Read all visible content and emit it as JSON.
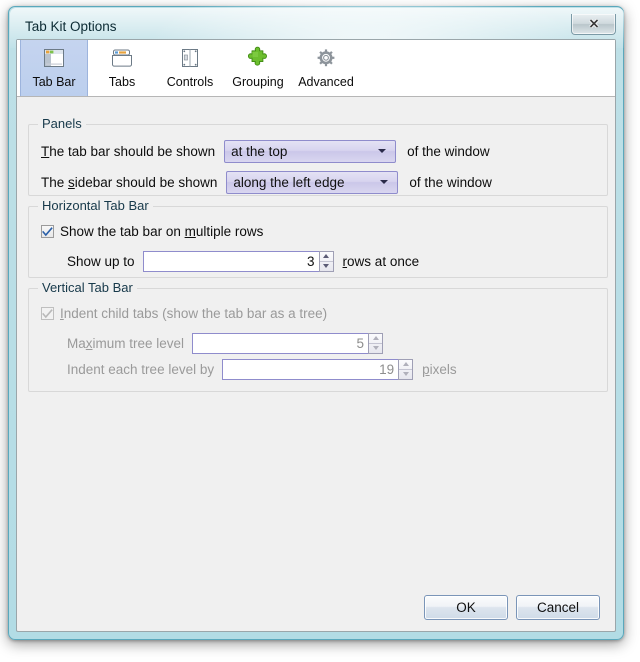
{
  "window": {
    "title": "Tab Kit Options",
    "close_icon": "close-icon"
  },
  "tabs": [
    {
      "label": "Tab Bar",
      "icon": "tab-bar-icon",
      "selected": true
    },
    {
      "label": "Tabs",
      "icon": "tabs-icon",
      "selected": false
    },
    {
      "label": "Controls",
      "icon": "controls-icon",
      "selected": false
    },
    {
      "label": "Grouping",
      "icon": "puzzle-piece-icon",
      "selected": false
    },
    {
      "label": "Advanced",
      "icon": "gear-icon",
      "selected": false
    }
  ],
  "panels": {
    "title": "Panels",
    "tab_bar_label_pre": "T",
    "tab_bar_label_post": "he tab bar should be shown",
    "tab_bar_value": "at the top",
    "tab_bar_suffix": "of the window",
    "sidebar_label_a": "The ",
    "sidebar_label_b": "s",
    "sidebar_label_c": "idebar should be shown",
    "sidebar_value": "along the left edge",
    "sidebar_suffix": "of the window"
  },
  "horizontal": {
    "title": "Horizontal Tab Bar",
    "checkbox_checked": true,
    "checkbox_label_a": "Show the tab bar on ",
    "checkbox_label_b": "m",
    "checkbox_label_c": "ultiple rows",
    "rows_label": "Show up to",
    "rows_value": "3",
    "rows_suffix_a": "r",
    "rows_suffix_b": "ows at once"
  },
  "vertical": {
    "title": "Vertical Tab Bar",
    "checkbox_checked": true,
    "checkbox_label_a": "I",
    "checkbox_label_b": "ndent child tabs (show the tab bar as a tree)",
    "max_level_label_a": "Ma",
    "max_level_label_b": "x",
    "max_level_label_c": "imum tree level",
    "max_level_value": "5",
    "indent_label": "Indent each tree level by",
    "indent_value": "19",
    "indent_suffix_a": "p",
    "indent_suffix_b": "ixels"
  },
  "footer": {
    "ok_label": "OK",
    "cancel_label": "Cancel"
  },
  "colors": {
    "frame": "#b2dce5",
    "client": "#f0f0f0",
    "tab_selected": "#c5d4ef",
    "combo_border": "#8f8ccc",
    "check_mark": "#2a5fa8",
    "disabled_text": "#9a9a9a"
  }
}
